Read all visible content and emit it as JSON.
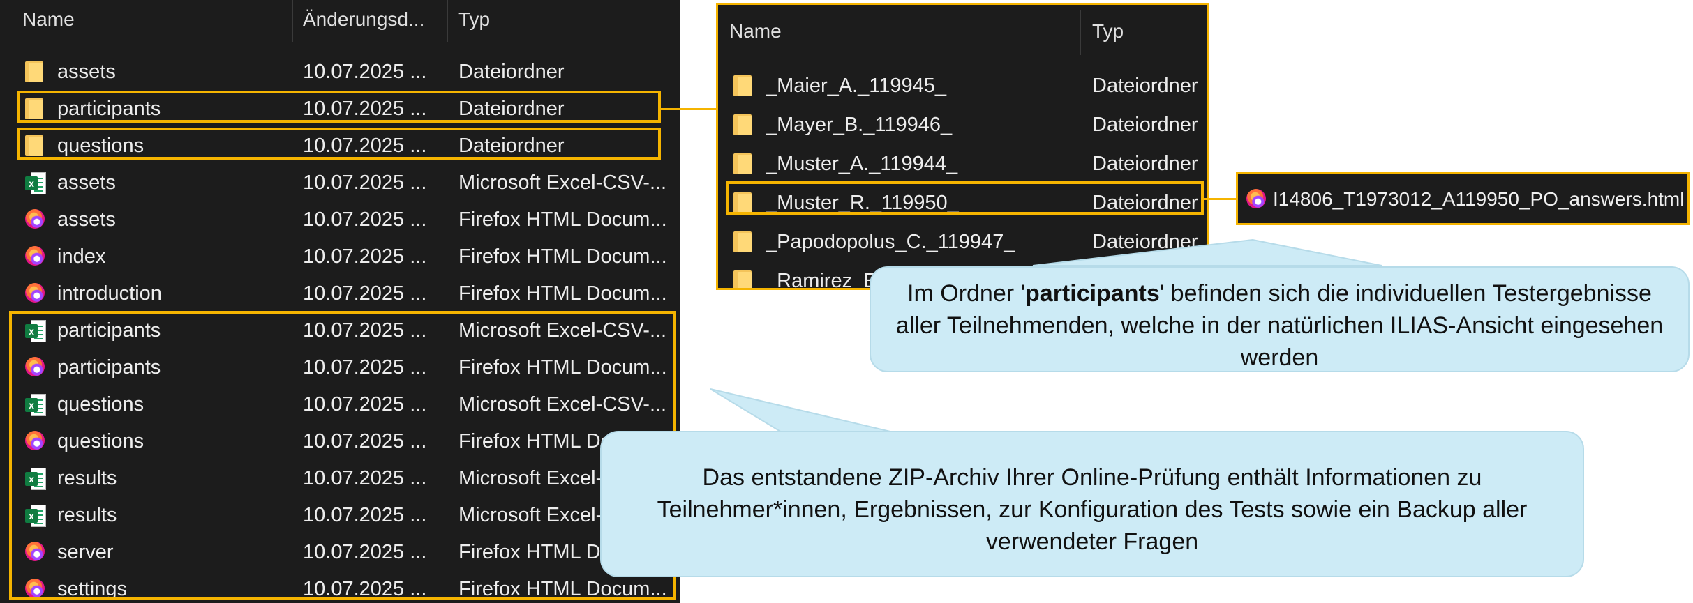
{
  "left_explorer": {
    "columns": {
      "name": "Name",
      "date": "Änderungsd...",
      "type": "Typ"
    },
    "rows": [
      {
        "icon": "folder-icon",
        "name": "assets",
        "date": "10.07.2025 ...",
        "type": "Dateiordner"
      },
      {
        "icon": "folder-icon",
        "name": "participants",
        "date": "10.07.2025 ...",
        "type": "Dateiordner"
      },
      {
        "icon": "folder-icon",
        "name": "questions",
        "date": "10.07.2025 ...",
        "type": "Dateiordner"
      },
      {
        "icon": "excel-csv-icon",
        "name": "assets",
        "date": "10.07.2025 ...",
        "type": "Microsoft Excel-CSV-..."
      },
      {
        "icon": "firefox-html-icon",
        "name": "assets",
        "date": "10.07.2025 ...",
        "type": "Firefox HTML Docum..."
      },
      {
        "icon": "firefox-html-icon",
        "name": "index",
        "date": "10.07.2025 ...",
        "type": "Firefox HTML Docum..."
      },
      {
        "icon": "firefox-html-icon",
        "name": "introduction",
        "date": "10.07.2025 ...",
        "type": "Firefox HTML Docum..."
      },
      {
        "icon": "excel-csv-icon",
        "name": "participants",
        "date": "10.07.2025 ...",
        "type": "Microsoft Excel-CSV-..."
      },
      {
        "icon": "firefox-html-icon",
        "name": "participants",
        "date": "10.07.2025 ...",
        "type": "Firefox HTML Docum..."
      },
      {
        "icon": "excel-csv-icon",
        "name": "questions",
        "date": "10.07.2025 ...",
        "type": "Microsoft Excel-CSV-..."
      },
      {
        "icon": "firefox-html-icon",
        "name": "questions",
        "date": "10.07.2025 ...",
        "type": "Firefox HTML Do"
      },
      {
        "icon": "excel-csv-icon",
        "name": "results",
        "date": "10.07.2025 ...",
        "type": "Microsoft Excel-"
      },
      {
        "icon": "excel-sheet-icon",
        "name": "results",
        "date": "10.07.2025 ...",
        "type": "Microsoft Excel-"
      },
      {
        "icon": "firefox-html-icon",
        "name": "server",
        "date": "10.07.2025 ...",
        "type": "Firefox HTML Do"
      },
      {
        "icon": "firefox-html-icon",
        "name": "settings",
        "date": "10.07.2025 ...",
        "type": "Firefox HTML Docum..."
      }
    ]
  },
  "right_explorer": {
    "columns": {
      "name": "Name",
      "type": "Typ"
    },
    "rows": [
      {
        "icon": "folder-icon",
        "name": "_Maier_A._119945_",
        "type": "Dateiordner"
      },
      {
        "icon": "folder-icon",
        "name": "_Mayer_B._119946_",
        "type": "Dateiordner"
      },
      {
        "icon": "folder-icon",
        "name": "_Muster_A._119944_",
        "type": "Dateiordner"
      },
      {
        "icon": "folder-icon",
        "name": "_Muster_R._119950_",
        "type": "Dateiordner"
      },
      {
        "icon": "folder-icon",
        "name": "_Papodopolus_C._119947_",
        "type": "Dateiordner"
      },
      {
        "icon": "folder-icon",
        "name": "_Ramirez_E",
        "type": ""
      }
    ]
  },
  "file_detail": {
    "icon": "firefox-html-icon",
    "name": "I14806_T1973012_A119950_PO_answers.html"
  },
  "callouts": {
    "participants": {
      "prefix": "Im Ordner '",
      "bold": "participants",
      "suffix": "' befinden sich die individuellen Testergebnisse aller Teilnehmenden, welche in der natürlichen ILIAS-Ansicht eingesehen werden"
    },
    "zip": {
      "text": "Das entstandene ZIP-Archiv Ihrer Online-Prüfung enthält Informationen zu Teilnehmer*innen, Ergebnissen, zur Konfiguration des Tests sowie ein Backup aller verwendeter Fragen"
    }
  },
  "colors": {
    "explorer_bg": "#1c1c1c",
    "highlight": "#f5b400",
    "callout_bg": "#cdebf6"
  }
}
